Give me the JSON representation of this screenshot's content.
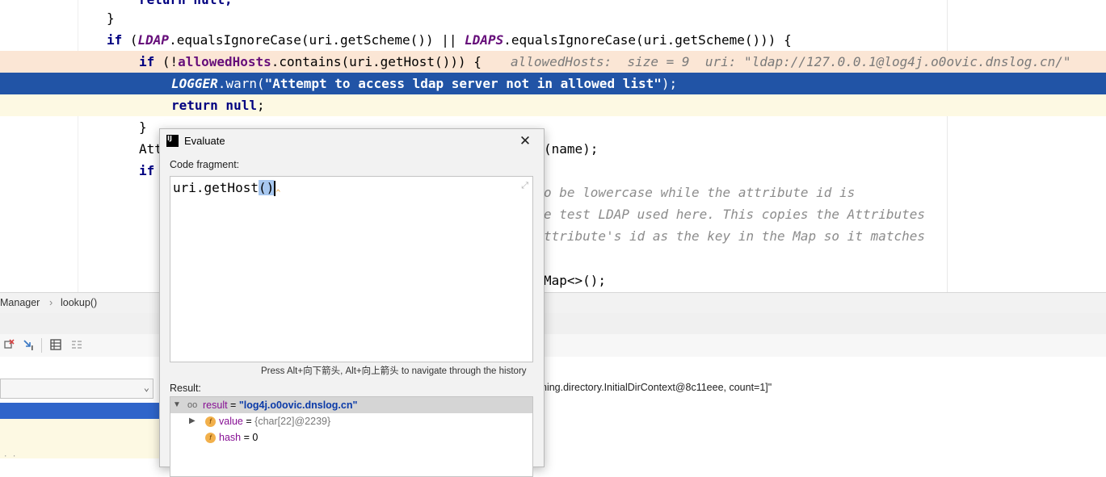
{
  "editor": {
    "lines": {
      "l0": "return null;",
      "l1": "}",
      "l2": {
        "kw_if": "if",
        "p1": " (",
        "ldap": "LDAP",
        "p2": ".equalsIgnoreCase(uri.getScheme()) || ",
        "ldaps": "LDAPS",
        "p3": ".equalsIgnoreCase(uri.getScheme())) {"
      },
      "l3": {
        "kw_if": "if",
        "p1": " (!",
        "field": "allowedHosts",
        "p2": ".contains(uri.getHost())) {"
      },
      "l3_hint": "allowedHosts:  size = 9  uri: \"ldap://127.0.0.1@log4j.o0ovic.dnslog.cn/\"",
      "l4": {
        "logger": "LOGGER",
        "p1": ".warn(",
        "str": "\"Attempt to access ldap server not in allowed list\"",
        "p2": ");"
      },
      "l5": {
        "kw": "return null",
        "p1": ";"
      },
      "l6": "}",
      "l7_left": "Att",
      "l7_right": "(name);",
      "l8_left": "if",
      "l9_right": "o be lowercase while the attribute id is",
      "l10_right": "e test LDAP used here. This copies the Attributes",
      "l11_right": "ttribute's id as the key in the Map so it matches",
      "l13_right": "Map<>();"
    }
  },
  "breadcrumb": {
    "item1": "Manager",
    "separator": "›",
    "item2": "lookup()"
  },
  "variables_panel": {
    "text": "ning.directory.InitialDirContext@8c11eee, count=1]\""
  },
  "dialog": {
    "logo": "IJ",
    "title": "Evaluate",
    "close": "✕",
    "code_label": "Code fragment:",
    "code_prefix": "uri.getHost",
    "code_parens": "()",
    "expand": "⤢",
    "history_hint": "Press Alt+向下箭头, Alt+向上箭头 to navigate through the history",
    "result_label": "Result:",
    "result": {
      "eye": "oo",
      "name": "result",
      "eq": " = ",
      "value": "\"log4j.o0ovic.dnslog.cn\"",
      "children": [
        {
          "name": "value",
          "eq": " = ",
          "value": "{char[22]@2239}"
        },
        {
          "name": "hash",
          "eq": " = ",
          "value": "0"
        }
      ]
    }
  },
  "colors": {
    "accent_selection": "#2154a6",
    "execution_line": "#fbe6d5"
  }
}
